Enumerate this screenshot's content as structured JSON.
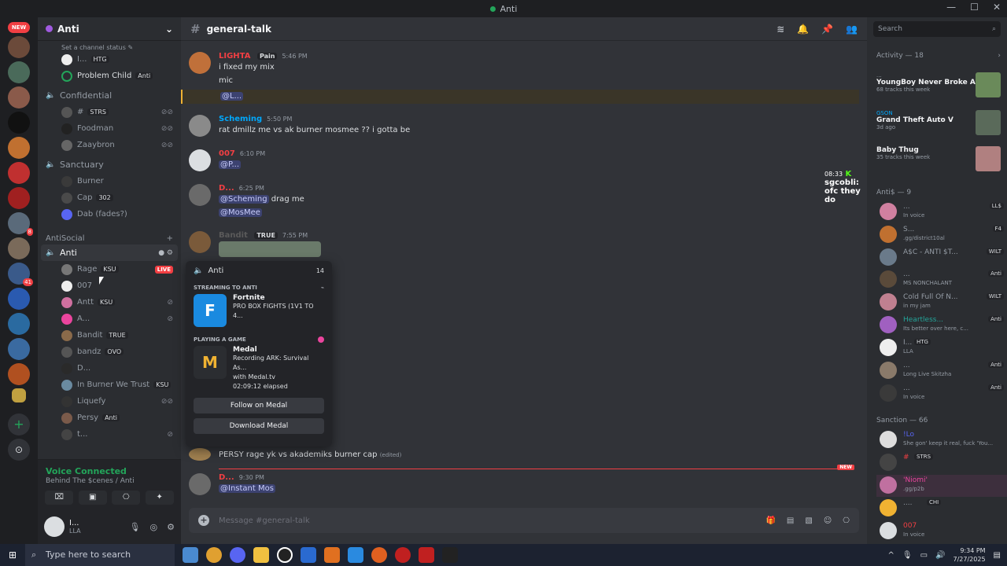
{
  "window": {
    "title": "Anti",
    "controls": [
      "—",
      "☐",
      "✕"
    ]
  },
  "servers": {
    "new_label": "NEW",
    "badges": [
      "8",
      "41"
    ]
  },
  "guild": {
    "name": "Anti",
    "chevron": "⌄"
  },
  "channels": {
    "status_hint": "Set a channel status ✎",
    "top_members": [
      {
        "name": "I...",
        "tag": "HTG"
      },
      {
        "name": "Problem Child",
        "tag": "Anti"
      }
    ],
    "confidential": {
      "name": "Confidential",
      "members": [
        {
          "name": "#",
          "tag": "STRS"
        },
        {
          "name": "Foodman"
        },
        {
          "name": "Zaaybron"
        }
      ]
    },
    "sanctuary": {
      "name": "Sanctuary",
      "members": [
        {
          "name": "Burner"
        },
        {
          "name": "Cap",
          "tag": "302"
        },
        {
          "name": "Dab (fades?)"
        }
      ]
    },
    "category": "AntiSocial",
    "anti": {
      "name": "Anti",
      "members": [
        {
          "name": "Rage",
          "tag": "KSU",
          "live": "LIVE"
        },
        {
          "name": "007"
        },
        {
          "name": "Antt",
          "tag": "KSU"
        },
        {
          "name": "A..."
        },
        {
          "name": "Bandit",
          "tag": "TRUE"
        },
        {
          "name": "bandz",
          "tag": "OVO"
        },
        {
          "name": "D..."
        },
        {
          "name": "In Burner We Trust",
          "tag": "KSU"
        },
        {
          "name": "Liquefy"
        },
        {
          "name": "Persy",
          "tag": "Anti"
        },
        {
          "name": "t..."
        }
      ]
    }
  },
  "voice": {
    "status": "Voice Connected",
    "location": "Behind The $cenes / Anti"
  },
  "user": {
    "name": "I...",
    "status": "LLA"
  },
  "chat": {
    "channel": "general-talk",
    "messages": [
      {
        "author": "LIGHTA",
        "role": "Pain",
        "time": "5:46 PM",
        "lines": [
          "i fixed my  mix",
          "mic"
        ],
        "mention": "@L..."
      },
      {
        "author": "Scheming",
        "time": "5:50 PM",
        "lines": [
          "rat dmillz me vs ak burner mosmee ?? i gotta be"
        ]
      },
      {
        "author": "007",
        "time": "6:10 PM",
        "mention": "@P..."
      },
      {
        "author": "D...",
        "time": "6:25 PM",
        "mention": "@Scheming",
        "after": " drag me",
        "mention2": "@MosMee"
      },
      {
        "author": "Bandit",
        "role": "TRUE",
        "time": "7:55 PM"
      },
      {
        "author": "",
        "lines": [
          "PERSY rage yk vs akademiks burner cap"
        ],
        "edited": "(edited)"
      },
      {
        "author": "D...",
        "time": "9:30 PM",
        "mention": "@Instant Mos"
      }
    ],
    "overlay": {
      "time": "08:33",
      "user": "sgcobli:",
      "text": "ofc they do"
    },
    "new_label": "NEW",
    "composer_placeholder": "Message #general-talk"
  },
  "popup": {
    "channel": "Anti",
    "count": "14",
    "streaming_label": "STREAMING TO ANTI",
    "stream_game": "Fortnite",
    "stream_title": "PRO BOX FIGHTS (1V1 TO 4...",
    "playing_label": "PLAYING A GAME",
    "game": "Medal",
    "game_line1": "Recording ARK: Survival As...",
    "game_line2": "with Medal.tv",
    "elapsed": "02:09:12 elapsed",
    "follow": "Follow on Medal",
    "download": "Download Medal"
  },
  "members": {
    "search_placeholder": "Search",
    "activity_header": "Activity — 18",
    "activities": [
      {
        "user": "...",
        "title": "YoungBoy Never Broke Again",
        "sub": "68 tracks this week"
      },
      {
        "user": "GSON",
        "title": "Grand Theft Auto V",
        "sub": "3d ago"
      },
      {
        "user": "",
        "title": "Baby Thug",
        "sub": "35 tracks this week"
      }
    ],
    "group1": "Anti$ — 9",
    "group1_members": [
      {
        "name": "...",
        "tag": "LL$",
        "sub": "In voice"
      },
      {
        "name": "S...",
        "tag": "F4",
        "sub": ".gg/district10al"
      },
      {
        "name": "A$C - ANTI $T...",
        "tag": "WILT",
        "sub": ""
      },
      {
        "name": "...",
        "tag": "Anti",
        "sub": "MS NONCHALANT"
      },
      {
        "name": "Cold Full Of N...",
        "tag": "WILT",
        "sub": "in my jam"
      },
      {
        "name": "Heartless...",
        "tag": "Anti",
        "sub": "Its better over here, c..."
      },
      {
        "name": "I...",
        "tag": "HTG",
        "sub": "LLA"
      },
      {
        "name": "...",
        "tag": "Anti",
        "sub": "Long Live Skitzha"
      },
      {
        "name": "...",
        "tag": "Anti",
        "sub": "In voice"
      }
    ],
    "group2": "Sanction — 66",
    "group2_members": [
      {
        "name": "!Lo",
        "sub": "She gon' keep it real, fuck 'You..."
      },
      {
        "name": "#",
        "tag": "STRS",
        "sub": ""
      },
      {
        "name": "'Niomi'",
        "sub": ".gg/p2b"
      },
      {
        "name": "....",
        "tag": "CHI",
        "sub": ""
      },
      {
        "name": "007",
        "sub": "In voice"
      }
    ]
  },
  "taskbar": {
    "search": "Type here to search",
    "time": "9:34 PM",
    "date": "7/27/2025"
  }
}
